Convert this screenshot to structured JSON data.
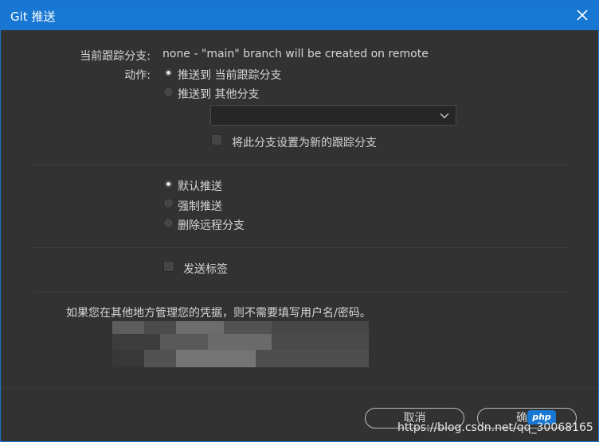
{
  "window": {
    "title": "Git 推送",
    "close_icon": "close-icon"
  },
  "tracking": {
    "label": "当前跟踪分支:",
    "value": "none - \"main\" branch will be created on remote"
  },
  "action": {
    "label": "动作:",
    "options": [
      {
        "label": "推送到 当前跟踪分支",
        "checked": true
      },
      {
        "label": "推送到 其他分支",
        "checked": false
      }
    ],
    "branch_select": {
      "value": ""
    },
    "set_tracking": {
      "label": "将此分支设置为新的跟踪分支",
      "checked": false
    }
  },
  "push_mode": {
    "options": [
      {
        "label": "默认推送",
        "checked": true
      },
      {
        "label": "强制推送",
        "checked": false
      },
      {
        "label": "删除远程分支",
        "checked": false
      }
    ]
  },
  "tags": {
    "label": "发送标签",
    "checked": false
  },
  "credentials": {
    "note": "如果您在其他地方管理您的凭据，则不需要填写用户名/密码。"
  },
  "buttons": {
    "cancel": "取消",
    "ok": "确"
  },
  "watermark": {
    "text": "https://blog.csdn.net/qq_30068165",
    "badge": "php"
  },
  "colors": {
    "accent": "#1777d3",
    "background": "#323232"
  }
}
